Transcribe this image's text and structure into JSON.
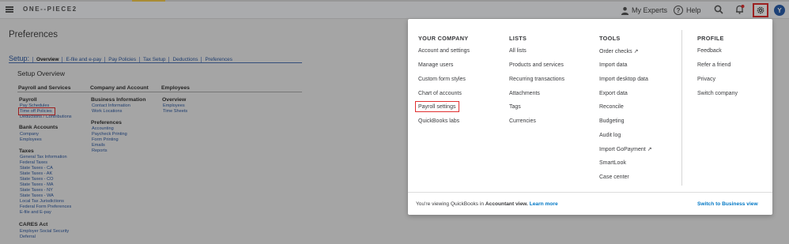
{
  "topbar": {
    "logo": "ONE--PIECE2",
    "my_experts": "My Experts",
    "help": "Help",
    "avatar_initial": "Y"
  },
  "page": {
    "title": "Preferences",
    "setup_label": "Setup:",
    "setup_tabs": [
      "Overview",
      "E-file and e-pay",
      "Pay Policies",
      "Tax Setup",
      "Deductions",
      "Preferences"
    ],
    "overview_title": "Setup Overview",
    "columns": [
      "Payroll and Services",
      "Company and Account",
      "Employees"
    ],
    "payroll": {
      "title": "Payroll",
      "links": [
        "Pay Schedules",
        "Time off Policies",
        "Deductions / Contributions"
      ]
    },
    "bank": {
      "title": "Bank Accounts",
      "links": [
        "Company",
        "Employees"
      ]
    },
    "taxes": {
      "title": "Taxes",
      "links": [
        "General Tax Information",
        "Federal Taxes",
        "State Taxes - CA",
        "State Taxes - AK",
        "State Taxes - CO",
        "State Taxes - MA",
        "State Taxes - NY",
        "State Taxes - WA",
        "Local Tax Jurisdictions",
        "Federal Form Preferences",
        "E-file and E-pay"
      ]
    },
    "cares": {
      "title": "CARES Act",
      "links": [
        "Employer Social Security",
        "Deferral"
      ]
    },
    "business": {
      "title": "Business Information",
      "links": [
        "Contact Information",
        "Work Locations"
      ]
    },
    "prefs": {
      "title": "Preferences",
      "links": [
        "Accounting",
        "Paycheck Printing",
        "Form Printing",
        "Emails",
        "Reports"
      ]
    },
    "emp_overview": {
      "title": "Overview",
      "links": [
        "Employees",
        "Time Sheets"
      ]
    }
  },
  "menu": {
    "your_company": {
      "title": "YOUR COMPANY",
      "items": [
        "Account and settings",
        "Manage users",
        "Custom form styles",
        "Chart of accounts",
        "Payroll settings",
        "QuickBooks labs"
      ]
    },
    "lists": {
      "title": "LISTS",
      "items": [
        "All lists",
        "Products and services",
        "Recurring transactions",
        "Attachments",
        "Tags",
        "Currencies"
      ]
    },
    "tools": {
      "title": "TOOLS",
      "items": [
        "Order checks",
        "Import data",
        "Import desktop data",
        "Export data",
        "Reconcile",
        "Budgeting",
        "Audit log",
        "Import GoPayment",
        "SmartLook",
        "Case center"
      ]
    },
    "profile": {
      "title": "PROFILE",
      "items": [
        "Feedback",
        "Refer a friend",
        "Privacy",
        "Switch company"
      ]
    },
    "footer": {
      "prefix": "You're viewing QuickBooks in",
      "view": "Accountant view.",
      "learn_more": "Learn more",
      "switch": "Switch to Business view"
    }
  },
  "colors": {
    "highlight_red": "#e03030",
    "link_blue": "#2f5aa0",
    "qb_blue": "#0077c5"
  }
}
